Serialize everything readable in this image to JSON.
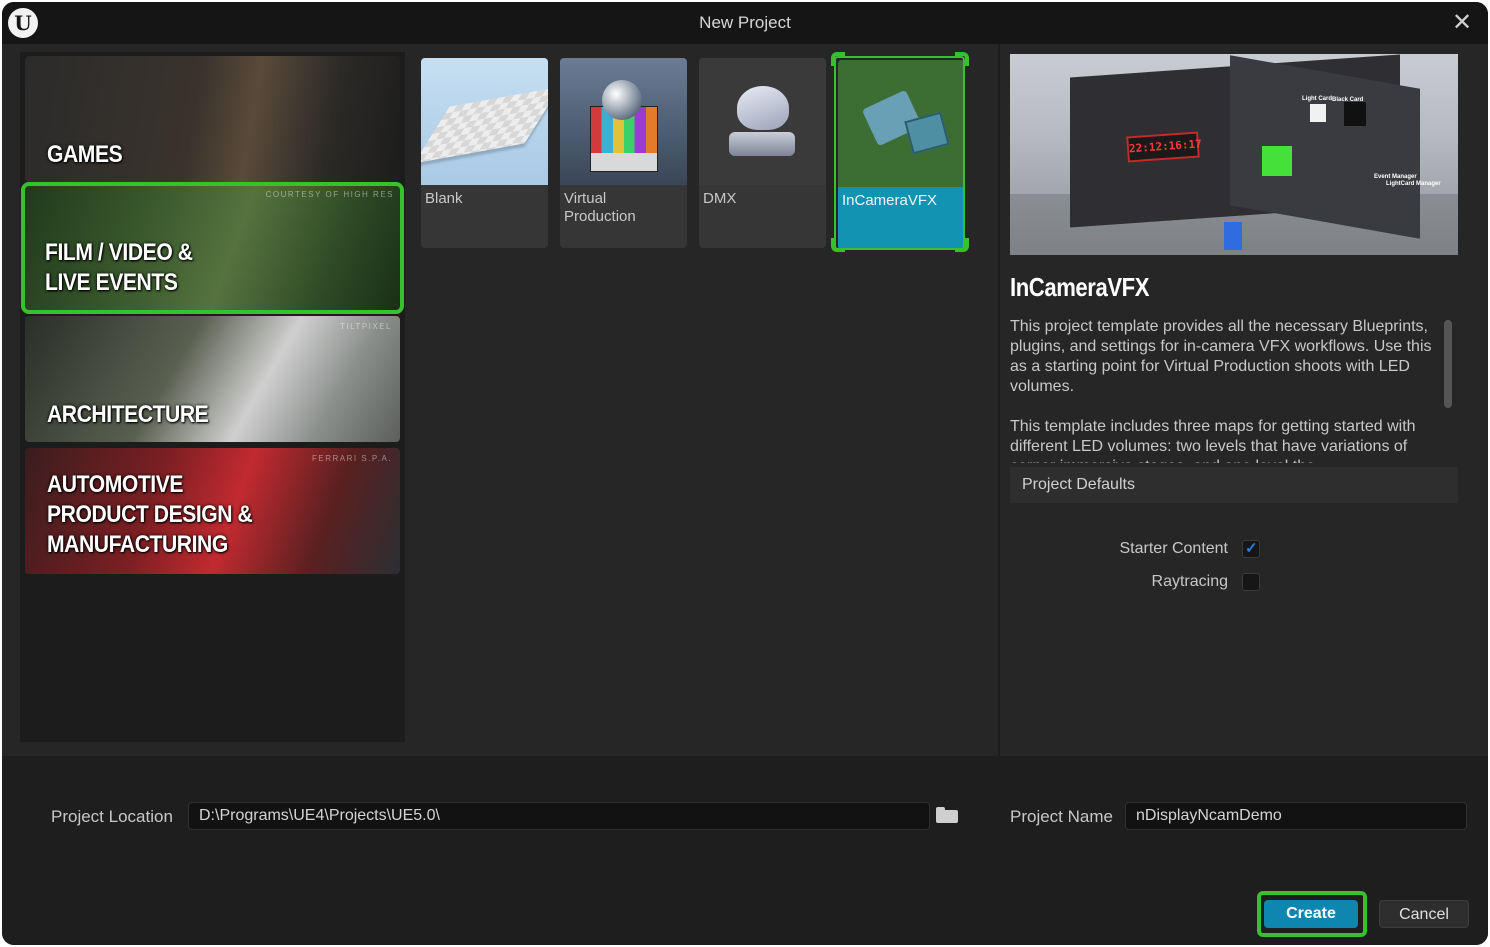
{
  "window": {
    "title": "New Project",
    "logo": "unreal-logo-icon",
    "close_icon": "close-icon"
  },
  "categories": [
    {
      "label": "GAMES",
      "credit": ""
    },
    {
      "label": "FILM / VIDEO &\nLIVE EVENTS",
      "credit": "COURTESY OF HIGH RES"
    },
    {
      "label": "ARCHITECTURE",
      "credit": "TILTPIXEL"
    },
    {
      "label": "AUTOMOTIVE\nPRODUCT DESIGN &\nMANUFACTURING",
      "credit": "FERRARI S.P.A."
    }
  ],
  "selected_category": "FILM / VIDEO & LIVE EVENTS",
  "templates": [
    {
      "name": "Blank"
    },
    {
      "name": "Virtual\nProduction"
    },
    {
      "name": "DMX"
    },
    {
      "name": "InCameraVFX"
    }
  ],
  "selected_template": "InCameraVFX",
  "preview": {
    "clock_text": "22:12:16:17",
    "card_label_1": "Light Card",
    "card_label_2": "Black Card",
    "manager_label_1": "Event Manager",
    "manager_label_2": "LightCard Manager"
  },
  "details": {
    "title": "InCameraVFX",
    "description_1": "This project template provides all the necessary Blueprints, plugins, and settings for in-camera VFX workflows. Use this as a starting point for Virtual Production shoots with LED volumes.",
    "description_2": "This template includes three maps for getting started with different LED volumes: two levels that have variations of corner immersive stages, and one level the"
  },
  "project_defaults": {
    "header": "Project Defaults",
    "starter_content_label": "Starter Content",
    "starter_content_checked": true,
    "raytracing_label": "Raytracing",
    "raytracing_checked": false
  },
  "location": {
    "label": "Project Location",
    "value": "D:\\Programs\\UE4\\Projects\\UE5.0\\",
    "browse_icon": "folder-icon"
  },
  "name": {
    "label": "Project Name",
    "value": "nDisplayNcamDemo"
  },
  "buttons": {
    "create": "Create",
    "cancel": "Cancel"
  },
  "highlight_color": "#37c12c",
  "accent_color": "#0f86b0"
}
